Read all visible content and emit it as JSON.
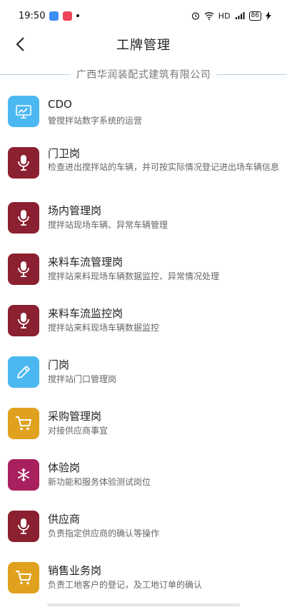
{
  "status": {
    "time": "19:50",
    "hd": "HD",
    "signal": "4G",
    "battery": "86"
  },
  "nav": {
    "title": "工牌管理"
  },
  "company": "广西华润装配式建筑有限公司",
  "items": [
    {
      "name": "CDO",
      "desc": "管搅拌站数字系统的运营",
      "icon": "dashboard-icon",
      "color": "#4cb8f2"
    },
    {
      "name": "门卫岗",
      "desc": "检查进出搅拌站的车辆，并可按实际情况登记进出场车辆信息",
      "icon": "microphone-icon",
      "color": "#8b2030"
    },
    {
      "name": "场内管理岗",
      "desc": "搅拌站现场车辆、异常车辆管理",
      "icon": "microphone-icon",
      "color": "#8b2030"
    },
    {
      "name": "来料车流管理岗",
      "desc": "搅拌站来料现场车辆数据监控、异常情况处理",
      "icon": "microphone-icon",
      "color": "#8b2030"
    },
    {
      "name": "来料车流监控岗",
      "desc": "搅拌站来料现场车辆数据监控",
      "icon": "microphone-icon",
      "color": "#8b2030"
    },
    {
      "name": "门岗",
      "desc": "搅拌站门口管理岗",
      "icon": "pencil-icon",
      "color": "#4cb8f2"
    },
    {
      "name": "采购管理岗",
      "desc": "对接供应商事宜",
      "icon": "cart-icon",
      "color": "#e0a21e"
    },
    {
      "name": "体验岗",
      "desc": "新功能和服务体验测试岗位",
      "icon": "snowflake-icon",
      "color": "#a8205e"
    },
    {
      "name": "供应商",
      "desc": "负责指定供应商的确认等操作",
      "icon": "microphone-icon",
      "color": "#8b2030"
    },
    {
      "name": "销售业务岗",
      "desc": "负责工地客户的登记，及工地订单的确认",
      "icon": "cart-icon",
      "color": "#e0a21e"
    }
  ]
}
